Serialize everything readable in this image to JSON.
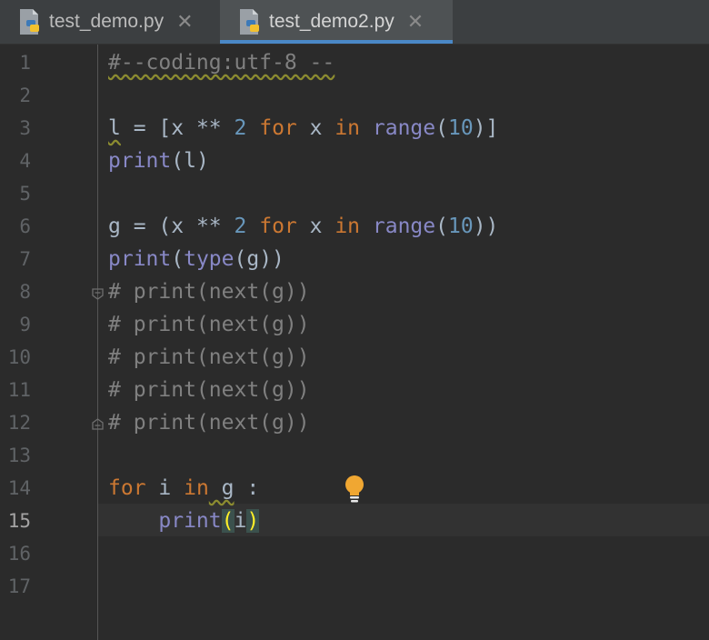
{
  "tabs": [
    {
      "label": "test_demo.py",
      "close": "✕"
    },
    {
      "label": "test_demo2.py",
      "close": "✕"
    }
  ],
  "colors": {
    "accent": "#4a88c7",
    "keyword": "#cc7832",
    "builtin": "#8888c6",
    "number": "#6897bb",
    "comment": "#808080"
  },
  "editor": {
    "current_line": 15,
    "line_numbers": [
      "1",
      "2",
      "3",
      "4",
      "5",
      "6",
      "7",
      "8",
      "9",
      "10",
      "11",
      "12",
      "13",
      "14",
      "15",
      "16",
      "17"
    ],
    "lines": {
      "l1": {
        "comment": "#--coding:utf-8 --"
      },
      "l3": {
        "var": "l",
        "eq": " = [x ",
        "op": "**",
        "sp": " ",
        "num": "2",
        "sp2": " ",
        "for": "for",
        "x": " x ",
        "in": "in",
        "sp3": " ",
        "range": "range",
        "open": "(",
        "n": "10",
        "close": ")]"
      },
      "l4": {
        "print": "print",
        "rest": "(l)"
      },
      "l6": {
        "pre": "g = (x ",
        "op": "**",
        "sp": " ",
        "num": "2",
        "sp2": " ",
        "for": "for",
        "x": " x ",
        "in": "in",
        "sp3": " ",
        "range": "range",
        "open": "(",
        "n": "10",
        "close": "))"
      },
      "l7": {
        "print": "print",
        "p1": "(",
        "type": "type",
        "rest": "(g))"
      },
      "l8": "# print(next(g))",
      "l9": "# print(next(g))",
      "l10": "# print(next(g))",
      "l11": "# print(next(g))",
      "l12": "# print(next(g))",
      "l14": {
        "for": "for",
        "i": " i ",
        "in": "in",
        "g": " g",
        "colon": " :"
      },
      "l15": {
        "indent": "    ",
        "print": "print",
        "open": "(",
        "i": "i",
        "close": ")"
      }
    },
    "intention_icon": "lightbulb-icon"
  }
}
